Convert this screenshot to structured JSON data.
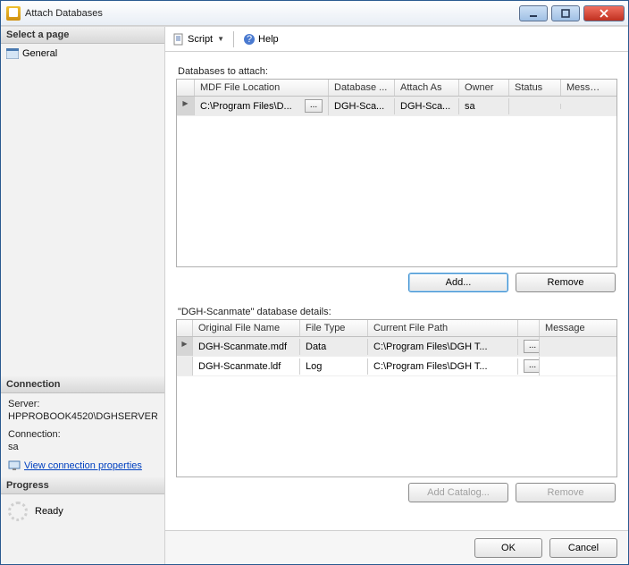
{
  "window": {
    "title": "Attach Databases"
  },
  "left": {
    "select_page": "Select a page",
    "general": "General",
    "connection_header": "Connection",
    "server_label": "Server:",
    "server_value": "HPPROBOOK4520\\DGHSERVER",
    "connection_label": "Connection:",
    "connection_value": "sa",
    "view_conn_props": "View connection properties",
    "progress_header": "Progress",
    "ready": "Ready"
  },
  "toolbar": {
    "script": "Script",
    "help": "Help"
  },
  "grid1": {
    "label": "Databases to attach:",
    "headers": [
      "",
      "MDF File Location",
      "Database ...",
      "Attach As",
      "Owner",
      "Status",
      "Message"
    ],
    "rows": [
      {
        "location": "C:\\Program Files\\D...",
        "dbname": "DGH-Sca...",
        "attach_as": "DGH-Sca...",
        "owner": "sa",
        "status": "",
        "message": ""
      }
    ],
    "add": "Add...",
    "remove": "Remove"
  },
  "grid2": {
    "label": "\"DGH-Scanmate\" database details:",
    "headers": [
      "Original File Name",
      "File Type",
      "Current File Path",
      "",
      "Message"
    ],
    "rows": [
      {
        "name": "DGH-Scanmate.mdf",
        "type": "Data",
        "path": "C:\\Program Files\\DGH T...",
        "message": ""
      },
      {
        "name": "DGH-Scanmate.ldf",
        "type": "Log",
        "path": "C:\\Program Files\\DGH T...",
        "message": ""
      }
    ],
    "add_catalog": "Add Catalog...",
    "remove": "Remove"
  },
  "footer": {
    "ok": "OK",
    "cancel": "Cancel"
  }
}
